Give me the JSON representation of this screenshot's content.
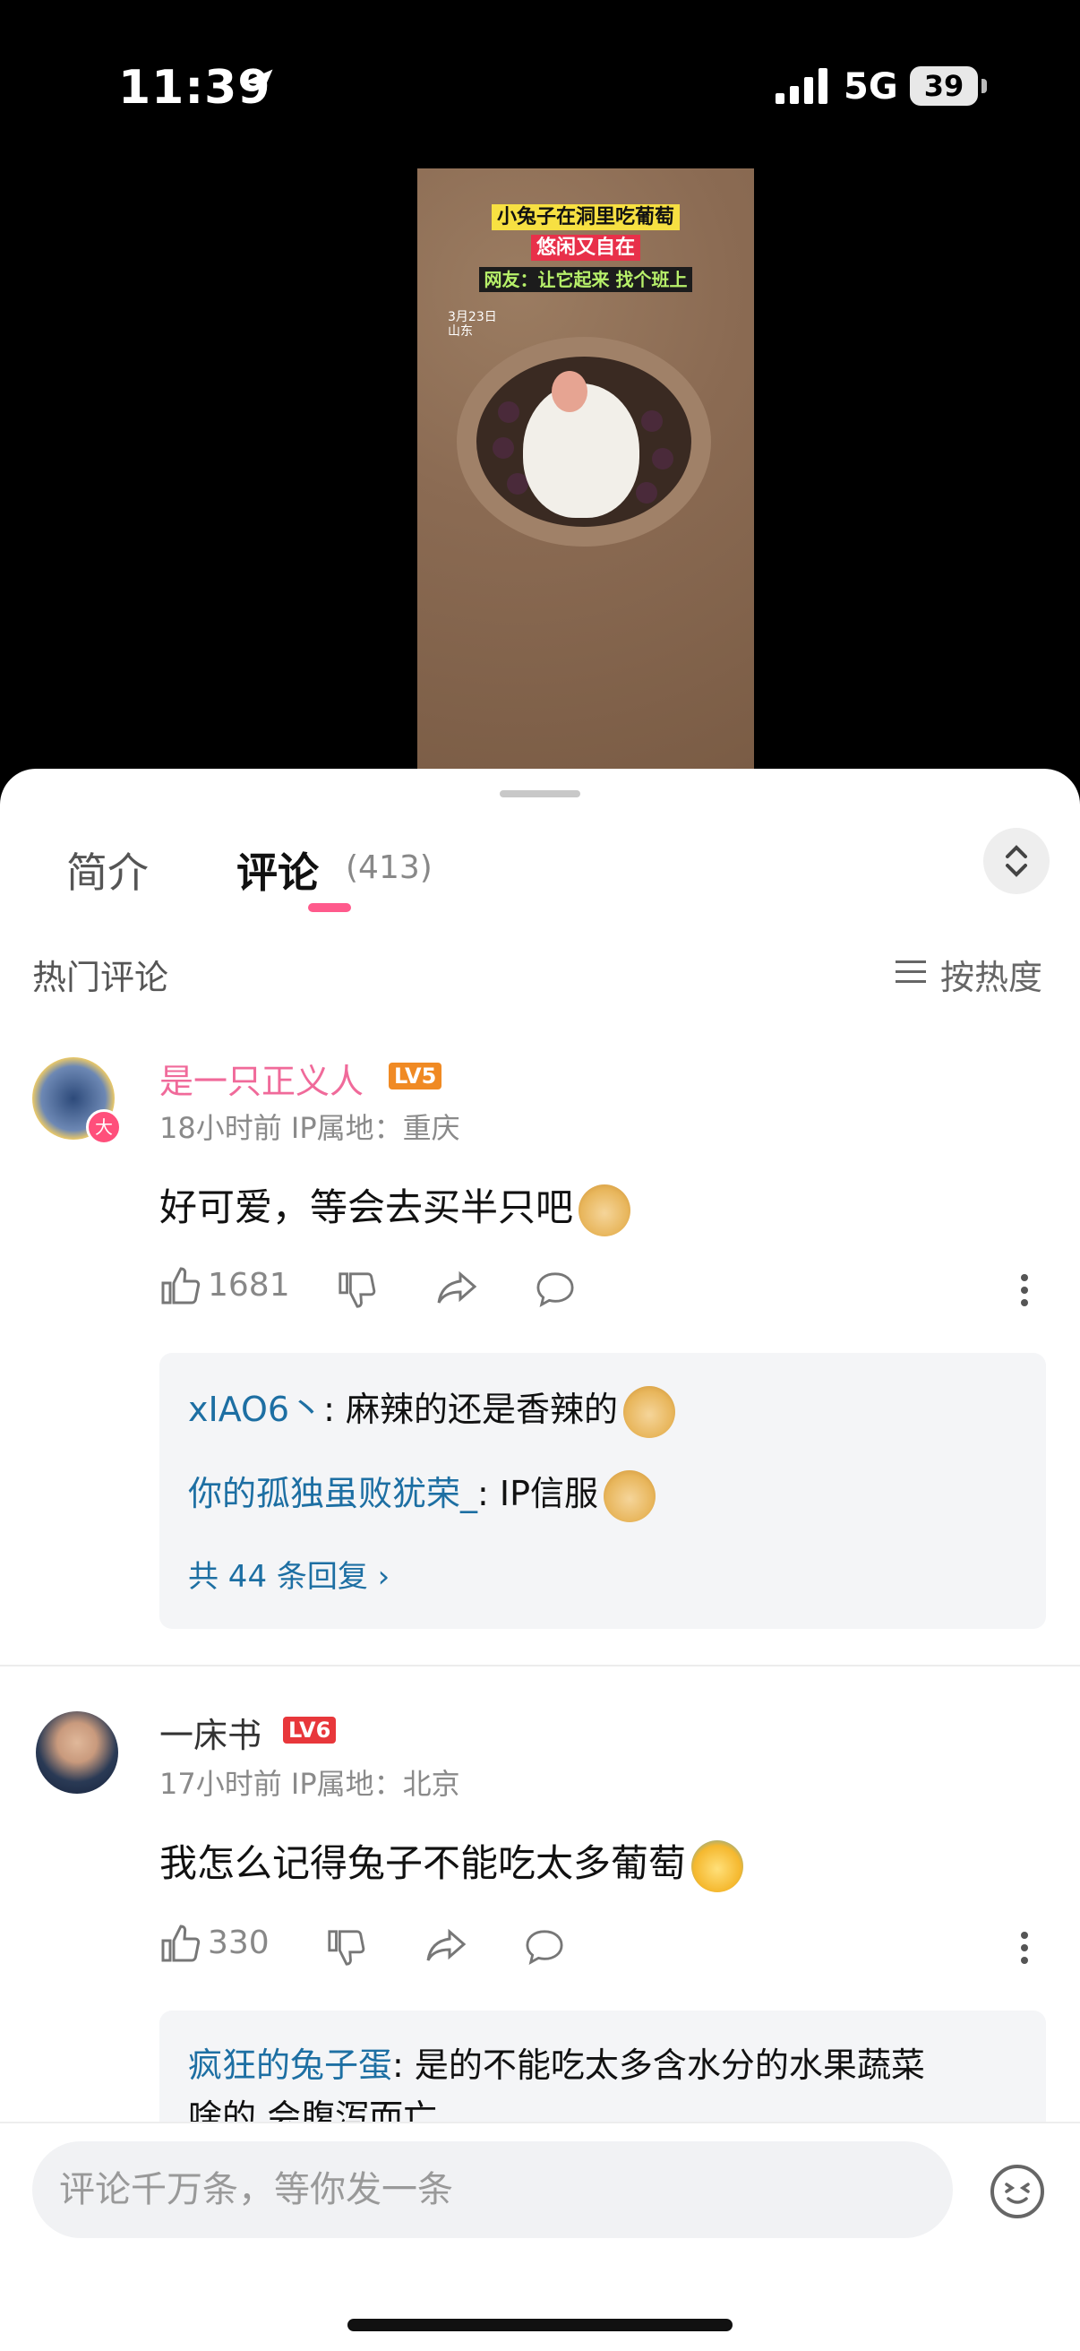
{
  "status_bar": {
    "time": "11:39",
    "network": "5G",
    "battery": "39"
  },
  "video": {
    "caption_line1": "小兔子在洞里吃葡萄",
    "caption_line2": "悠闲又自在",
    "caption_line3": "网友：让它起来 找个班上",
    "date_line1": "3月23日",
    "date_line2": "山东"
  },
  "tabs": {
    "intro": "简介",
    "comments": "评论",
    "count": "(413)"
  },
  "hot": {
    "label": "热门评论",
    "sort_label": "按热度"
  },
  "comments": [
    {
      "username": "是一只正义人",
      "level": "LV5",
      "avatar_badge": "大",
      "meta": "18小时前  IP属地：重庆",
      "text": "好可爱，等会去买半只吧",
      "likes": "1681",
      "replies": [
        {
          "name": "xIAO6丶",
          "text": ": 麻辣的还是香辣的"
        },
        {
          "name": "你的孤独虽败犹荣_",
          "text": ": IP信服"
        }
      ],
      "more_replies": "共 44 条回复 ›"
    },
    {
      "username": "一床书",
      "level": "LV6",
      "meta": "17小时前  IP属地：北京",
      "text": "我怎么记得兔子不能吃太多葡萄",
      "likes": "330",
      "replies": [
        {
          "name": "疯狂的兔子蛋",
          "text": ": 是的不能吃太多含水分的水果蔬菜",
          "text2": "啥的 会腹泻而亡"
        }
      ]
    }
  ],
  "input": {
    "placeholder": "评论千万条，等你发一条"
  },
  "colors": {
    "accent": "#ff5a8c",
    "link": "#1d6fa3",
    "lv5": "#f08a24",
    "lv6": "#e8373b"
  }
}
